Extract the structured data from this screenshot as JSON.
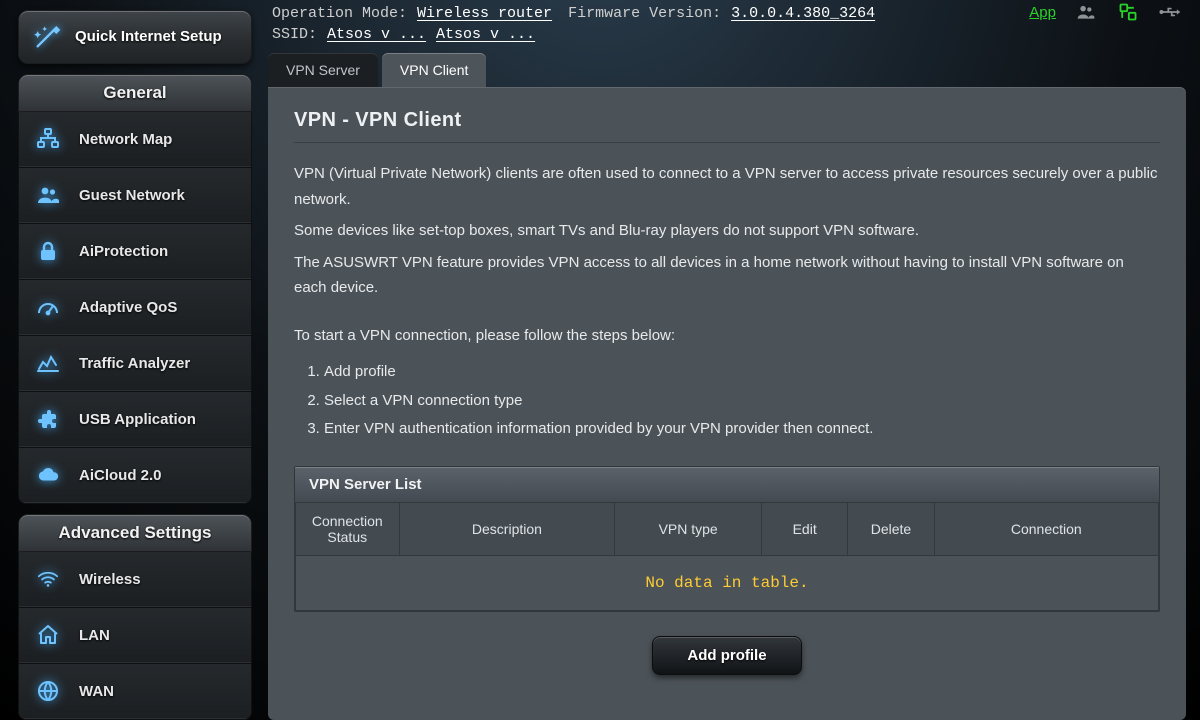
{
  "quick_setup": "Quick Internet Setup",
  "sections": {
    "general": {
      "title": "General",
      "items": [
        "Network Map",
        "Guest Network",
        "AiProtection",
        "Adaptive QoS",
        "Traffic Analyzer",
        "USB Application",
        "AiCloud 2.0"
      ]
    },
    "advanced": {
      "title": "Advanced Settings",
      "items": [
        "Wireless",
        "LAN",
        "WAN"
      ]
    }
  },
  "status": {
    "op_label": "Operation Mode:",
    "op_value": "Wireless router",
    "fw_label": "Firmware Version:",
    "fw_value": "3.0.0.4.380_3264",
    "ssid_label": "SSID:",
    "ssid_a": "Atsos v ...",
    "ssid_b": "Atsos v ...",
    "app": "App"
  },
  "tabs": [
    "VPN Server",
    "VPN Client"
  ],
  "active_tab": 1,
  "content": {
    "heading": "VPN - VPN Client",
    "p1": "VPN (Virtual Private Network) clients are often used to connect to a VPN server to access private resources securely over a public network.",
    "p2": "Some devices like set-top boxes, smart TVs and Blu-ray players do not support VPN software.",
    "p3": "The ASUSWRT VPN feature provides VPN access to all devices in a home network without having to install VPN software on each device.",
    "p4": "To start a VPN connection, please follow the steps below:",
    "steps": [
      "Add profile",
      "Select a VPN connection type",
      "Enter VPN authentication information provided by your VPN provider then connect."
    ],
    "table_title": "VPN Server List",
    "columns": [
      "Connection Status",
      "Description",
      "VPN type",
      "Edit",
      "Delete",
      "Connection"
    ],
    "empty": "No data in table.",
    "add_btn": "Add profile"
  }
}
